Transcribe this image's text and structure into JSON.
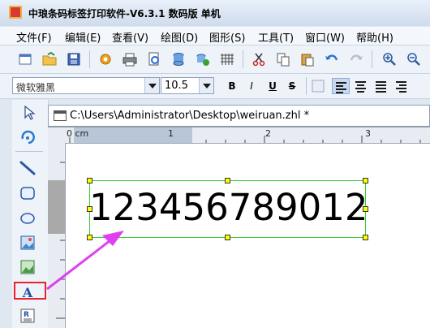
{
  "window": {
    "title": "中琅条码标签打印软件-V6.3.1 数码版 单机"
  },
  "menu": [
    {
      "label": "文件(F)"
    },
    {
      "label": "编辑(E)"
    },
    {
      "label": "查看(V)"
    },
    {
      "label": "绘图(D)"
    },
    {
      "label": "图形(S)"
    },
    {
      "label": "工具(T)"
    },
    {
      "label": "窗口(W)"
    },
    {
      "label": "帮助(H)"
    }
  ],
  "toolbar": {
    "icons": [
      "new-icon",
      "open-icon",
      "save-icon",
      "settings-icon",
      "print-icon",
      "print-preview-icon",
      "database-icon",
      "data-source-icon",
      "grid-icon",
      "cut-icon",
      "copy-icon",
      "paste-icon",
      "undo-icon",
      "redo-icon",
      "zoom-in-icon",
      "zoom-out-icon"
    ]
  },
  "format": {
    "font_name": "微软雅黑",
    "font_size": "10.5",
    "bold_label": "B",
    "italic_label": "I",
    "underline_label": "U",
    "strike_label": "S"
  },
  "left_tools": [
    "select-icon",
    "rotate-icon",
    "line-icon",
    "rounded-rect-icon",
    "ellipse-icon",
    "image-icon",
    "picture-icon",
    "text-icon",
    "rich-text-icon"
  ],
  "document": {
    "tab_path": "C:\\Users\\Administrator\\Desktop\\weiruan.zhl *"
  },
  "ruler": {
    "unit_label": "0 cm",
    "marks": [
      "1",
      "2",
      "3"
    ]
  },
  "canvas": {
    "text_content": "123456789012"
  },
  "colors": {
    "highlight_box": "#e8232a",
    "arrow": "#e040f0",
    "selection": "#33cc33",
    "handle": "#ffff00"
  }
}
